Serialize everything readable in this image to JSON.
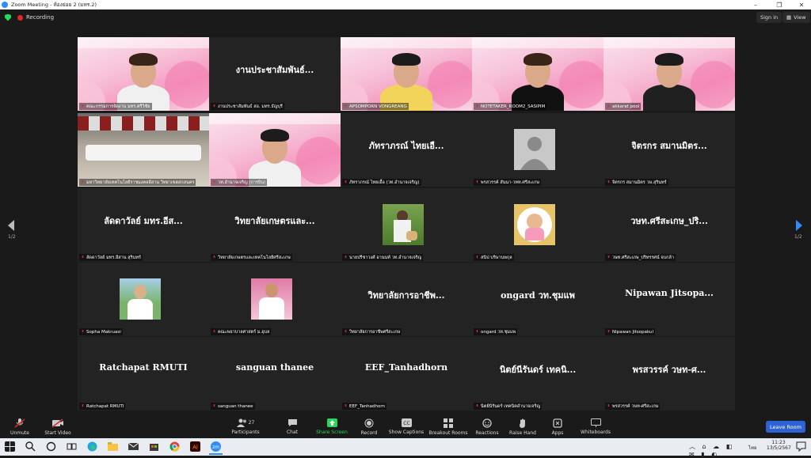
{
  "window": {
    "title": "Zoom Meeting - ห้องย่อย 2 (มหร.2)"
  },
  "topbar": {
    "recording_label": "Recording",
    "signin_label": "Sign in",
    "view_label": "View"
  },
  "nav": {
    "page_left": "1/2",
    "page_right": "1/2"
  },
  "tiles": [
    {
      "type": "video",
      "caption": "คณะกรรมการจัดงาน มทร.ศรีวิชัย"
    },
    {
      "type": "name",
      "big": "งานประชาสัมพันธ์...",
      "caption": "งานประชาสัมพันธ์ สอ. มทร.ธัญบุรี"
    },
    {
      "type": "video",
      "caption": "APSOMPORN VONGREANG"
    },
    {
      "type": "video",
      "caption": "NOTETAKER_ROOM2_SASIPIM"
    },
    {
      "type": "video",
      "caption": "akkarat pool"
    },
    {
      "type": "video",
      "caption": "มหาวิทยาลัยเทคโนโลยีราชมงคลอีสาน วิทยาเขตสกลนคร"
    },
    {
      "type": "video",
      "caption": "วท.อำนาจเจริญ (การบิน)"
    },
    {
      "type": "name",
      "big": "ภัทราภรณ์ ไทยเอื...",
      "caption": "ภัทราภรณ์ ไทยเอื้อ (วท.อำนาจเจริญ)"
    },
    {
      "type": "avatar",
      "caption": "พรสวรรค์ สันนา-วทท.ศรีสะเกษ"
    },
    {
      "type": "name",
      "big": "จิตรกร สมานมิตร...",
      "caption": "จิตรกร สมานมิตร วษ.สุรินทร์"
    },
    {
      "type": "name",
      "big": "ลัดดาวัลย์ มทร.อีส...",
      "caption": "ลัดดาวัลย์ มทร.อีสาน สุรินทร์"
    },
    {
      "type": "name",
      "big": "วิทยาลัยเกษตรและ...",
      "caption": "วิทยาลัยเกษตรและเทคโนโลยีศรีสะเกษ"
    },
    {
      "type": "photo",
      "caption": "นายปรีชาวงศ์ อานนท์ วท.อำนาจเจริญ"
    },
    {
      "type": "photo2",
      "caption": "สนิป บริษานพกุล"
    },
    {
      "type": "name",
      "big": "วษท.ศรีสะเกษ_ปริ...",
      "caption": "วษท.ศรีสะเกษ_ปริทรรศน์ จบกล้า"
    },
    {
      "type": "photo3",
      "caption": "Sopha Makruasi"
    },
    {
      "type": "photo4",
      "caption": "คณะพยาบาลศาสตร์ ม.อุบล"
    },
    {
      "type": "name",
      "big": "วิทยาลัยการอาชีพ...",
      "caption": "วิทยาลัยการอาชีพศรีสะเกษ"
    },
    {
      "type": "name",
      "big": "ongard วท.ชุมแพ",
      "caption": "ongard วท.ชุมแพ"
    },
    {
      "type": "name",
      "big": "Nipawan Jitsopa...",
      "caption": "Nipawan Jitsopakul"
    },
    {
      "type": "name",
      "big": "Ratchapat RMUTI",
      "caption": "Ratchapat RMUTI"
    },
    {
      "type": "name",
      "big": "sanguan thanee",
      "caption": "sanguan thanee"
    },
    {
      "type": "name",
      "big": "EEF_Tanhadhorn",
      "caption": "EEF_Tanhadhorn"
    },
    {
      "type": "name",
      "big": "นิตย์นีรันดร์ เทคนิ...",
      "caption": "นิตย์นีรันดร์ เทคนิคอำนาจเจริญ"
    },
    {
      "type": "name",
      "big": "พรสวรรค์ วษท-ศ...",
      "caption": "พรสวรรค์ วษท-ศรีสะเกษ"
    }
  ],
  "toolbar": {
    "unmute": "Unmute",
    "start_video": "Start Video",
    "participants": "Participants",
    "participants_count": "27",
    "chat": "Chat",
    "share_screen": "Share Screen",
    "record": "Record",
    "show_captions": "Show Captions",
    "breakout_rooms": "Breakout Rooms",
    "reactions": "Reactions",
    "raise_hand": "Raise Hand",
    "apps": "Apps",
    "whiteboards": "Whiteboards",
    "leave_room": "Leave Room"
  },
  "taskbar": {
    "time": "11:23",
    "date": "13/5/2567",
    "lang": "ไทย"
  },
  "colors": {
    "accent_blue": "#2d8cff",
    "active_speaker": "#e8f64a",
    "recording_red": "#e02828",
    "share_green": "#23d959"
  }
}
